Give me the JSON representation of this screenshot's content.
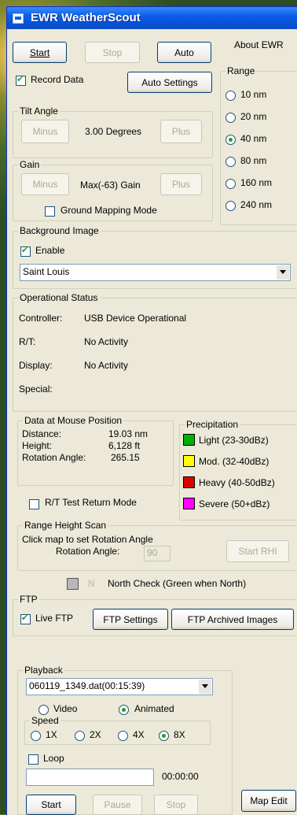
{
  "window": {
    "title": "EWR WeatherScout"
  },
  "top": {
    "start": "Start",
    "stop": "Stop",
    "auto": "Auto",
    "about": "About EWR",
    "record_data": "Record Data",
    "auto_settings": "Auto Settings"
  },
  "range": {
    "label": "Range",
    "options": [
      "10 nm",
      "20 nm",
      "40 nm",
      "80 nm",
      "160 nm",
      "240 nm"
    ],
    "selected": "40 nm"
  },
  "tilt": {
    "label": "Tilt Angle",
    "minus": "Minus",
    "value": "3.00 Degrees",
    "plus": "Plus"
  },
  "gain": {
    "label": "Gain",
    "minus": "Minus",
    "value": "Max(-63)  Gain",
    "plus": "Plus",
    "ground_mapping": "Ground Mapping Mode"
  },
  "background": {
    "label": "Background Image",
    "enable": "Enable",
    "location": "Saint Louis"
  },
  "status": {
    "label": "Operational Status",
    "rows": [
      {
        "k": "Controller:",
        "v": "USB Device Operational"
      },
      {
        "k": "R/T:",
        "v": "No Activity"
      },
      {
        "k": "Display:",
        "v": "No Activity"
      },
      {
        "k": "Special:",
        "v": ""
      }
    ]
  },
  "mouse": {
    "label": "Data at Mouse Position",
    "distance_k": "Distance:",
    "distance_v": "19.03 nm",
    "height_k": "Height:",
    "height_v": "6,128 ft",
    "rotation_k": "Rotation Angle:",
    "rotation_v": "265.15"
  },
  "precip": {
    "label": "Precipitation",
    "items": [
      {
        "label": "Light (23-30dBz)",
        "color": "#00b000"
      },
      {
        "label": "Mod. (32-40dBz)",
        "color": "#ffff00"
      },
      {
        "label": "Heavy (40-50dBz)",
        "color": "#e00000"
      },
      {
        "label": "Severe (50+dBz)",
        "color": "#ff00ff"
      }
    ]
  },
  "rt_test": "R/T Test Return Mode",
  "rhi": {
    "label": "Range Height Scan",
    "instruction": "Click map to set Rotation Angle",
    "angle_label": "Rotation Angle:",
    "angle_value": "90",
    "start": "Start RHI"
  },
  "north": {
    "letter": "N",
    "text": "North Check (Green when North)"
  },
  "ftp": {
    "label": "FTP",
    "live": "Live FTP",
    "settings": "FTP Settings",
    "archived": "FTP Archived Images"
  },
  "playback": {
    "label": "Playback",
    "file": "060119_1349.dat(00:15:39)",
    "video": "Video",
    "animated": "Animated",
    "speed_label": "Speed",
    "speeds": [
      "1X",
      "2X",
      "4X",
      "8X"
    ],
    "speed_selected": "8X",
    "loop": "Loop",
    "time": "00:00:00",
    "start": "Start",
    "pause": "Pause",
    "stop": "Stop"
  },
  "map_edit": "Map Edit"
}
